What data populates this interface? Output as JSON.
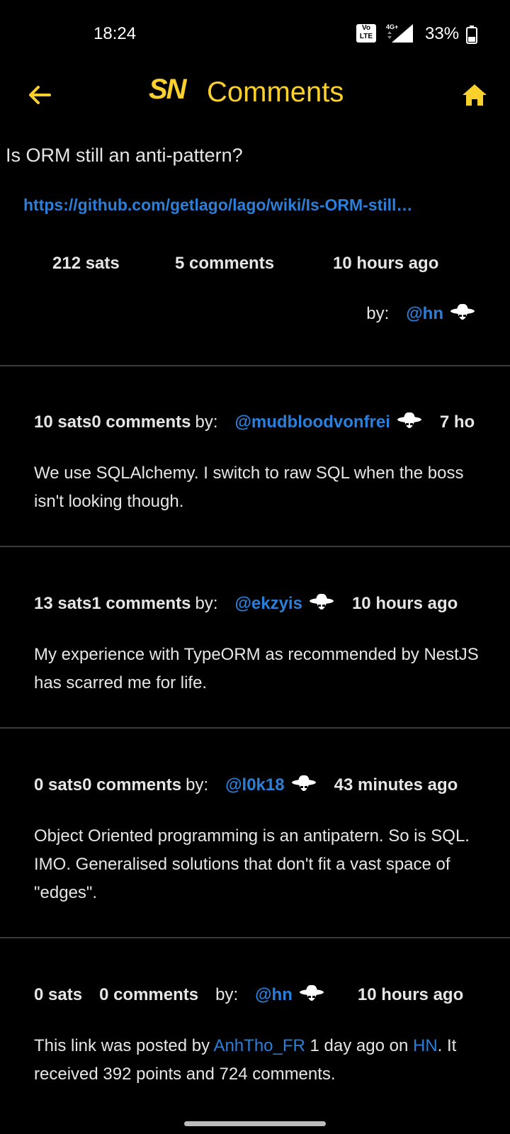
{
  "status_bar": {
    "time": "18:24",
    "volte": "Vo LTE",
    "network": "4G+",
    "battery": "33%"
  },
  "app_bar": {
    "logo": "SN",
    "title": "Comments",
    "accent_color": "#fad02c"
  },
  "post": {
    "title": "Is ORM still an anti-pattern?",
    "url": "https://github.com/getlago/lago/wiki/Is-ORM-still…",
    "sats": "212 sats",
    "comments": "5 comments",
    "time": "10 hours ago",
    "by_label": "by:",
    "author": "@hn"
  },
  "comments": [
    {
      "sats": "10 sats",
      "count": "0 comments",
      "by_label": "by:",
      "author": "@mudbloodvonfrei",
      "time": "7 ho",
      "body": "We use SQLAlchemy. I switch to raw SQL  when the boss isn't looking though."
    },
    {
      "sats": "13 sats",
      "count": "1 comments",
      "by_label": "by:",
      "author": "@ekzyis",
      "time": "10 hours ago",
      "body": "My experience with TypeORM as recommended by NestJS has scarred me for life."
    },
    {
      "sats": "0 sats",
      "count": "0 comments",
      "by_label": "by:",
      "author": "@l0k18",
      "time": "43 minutes ago",
      "body": "Object Oriented programming is an antipatern. So is SQL. IMO. Generalised solutions that don't fit a vast space of \"edges\"."
    },
    {
      "sats": "0 sats",
      "count": "0 comments",
      "by_label": "by:",
      "author": "@hn",
      "time": "10 hours ago",
      "body_part1": "This link was posted by ",
      "body_link1": "AnhTho_FR",
      "body_part2": " 1 day ago on ",
      "body_link2": "HN",
      "body_part3": ". It received 392 points and 724 comments."
    }
  ],
  "colors": {
    "background": "#000000",
    "link": "#2b7fd9",
    "text": "#e6e6e6",
    "divider": "#3a3a3a"
  }
}
